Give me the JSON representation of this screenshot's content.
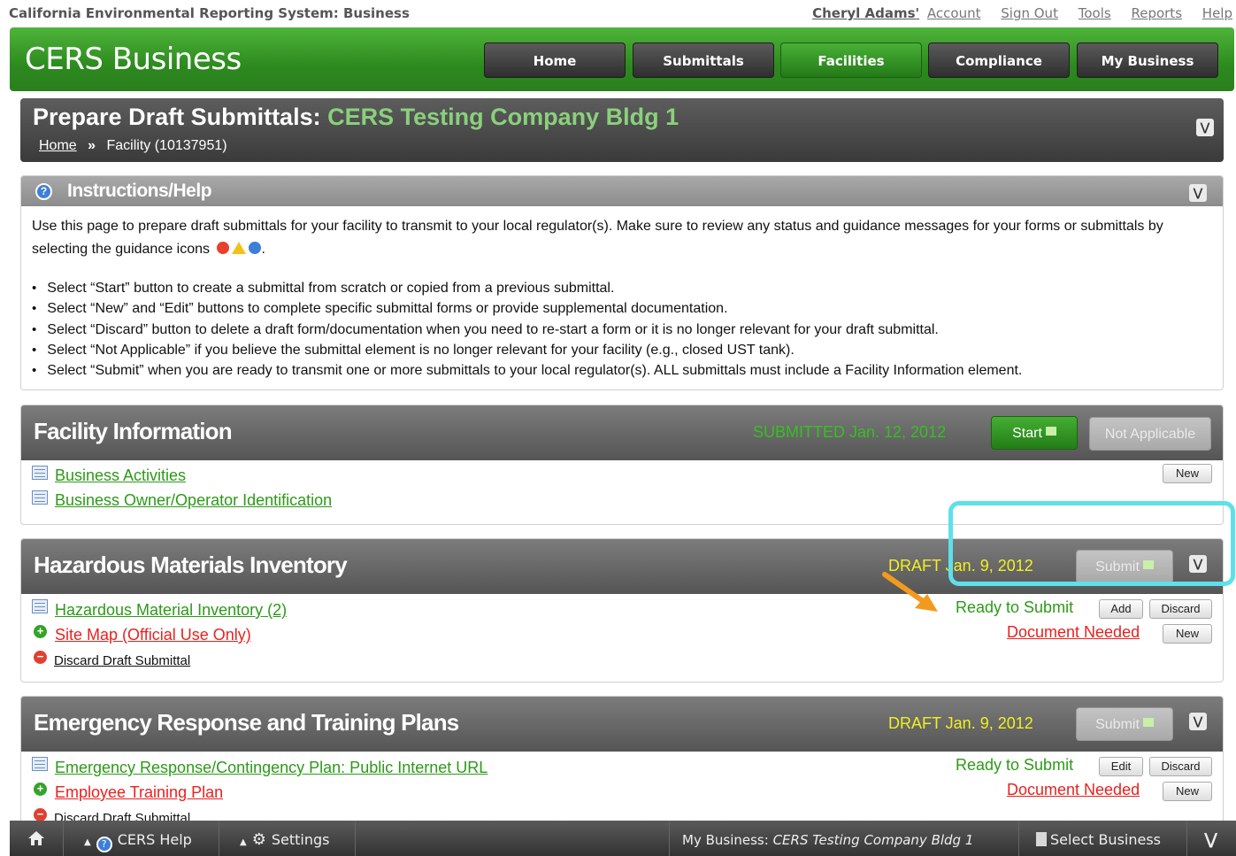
{
  "system_title": "California Environmental Reporting System: Business",
  "top_links": {
    "account_name": "Cheryl Adams'",
    "account": "Account",
    "sign_out": "Sign Out",
    "tools": "Tools",
    "reports": "Reports",
    "help": "Help"
  },
  "brand": "CERS Business",
  "nav": [
    "Home",
    "Submittals",
    "Facilities",
    "Compliance",
    "My Business"
  ],
  "nav_active": "Facilities",
  "page": {
    "title_prefix": "Prepare Draft Submittals:",
    "facility_name": "CERS Testing Company Bldg 1",
    "breadcrumb_home": "Home",
    "breadcrumb_sep": "»",
    "breadcrumb_current": "Facility (10137951)"
  },
  "instructions": {
    "title": "Instructions/Help",
    "intro_1": "Use this page to prepare draft submittals for your facility to transmit to your local regulator(s). Make sure to review any status and guidance messages for your forms or submittals by selecting the guidance icons",
    "intro_end": ".",
    "bullets": [
      "Select “Start” button to create a submittal from scratch or copied from a previous submittal.",
      "Select “New” and “Edit” buttons to complete specific submittal forms or provide supplemental documentation.",
      "Select “Discard” button to delete a draft form/documentation when you need to re-start a form or it is no longer relevant for your draft submittal.",
      "Select “Not Applicable” if you believe the submittal element is no longer relevant for your facility (e.g., closed UST tank).",
      "Select “Submit” when you are ready to transmit one or more submittals to your local regulator(s). ALL submittals must include a Facility Information element."
    ]
  },
  "sections": {
    "facility": {
      "title": "Facility Information",
      "status": "SUBMITTED Jan. 12, 2012",
      "start": "Start",
      "not_applicable": "Not Applicable",
      "items": [
        "Business Activities",
        "Business Owner/Operator Identification"
      ],
      "new": "New"
    },
    "hmi": {
      "title": "Hazardous Materials Inventory",
      "status": "DRAFT Jan. 9, 2012",
      "submit": "Submit",
      "item1": "Hazardous Material Inventory (2)",
      "item1_status": "Ready to Submit",
      "add": "Add",
      "discard": "Discard",
      "item2": "Site Map (Official Use Only)",
      "item2_status": "Document Needed",
      "new": "New",
      "discard_draft": "Discard Draft Submittal"
    },
    "ertp": {
      "title": "Emergency Response and Training Plans",
      "status": "DRAFT Jan. 9, 2012",
      "submit": "Submit",
      "item1": "Emergency Response/Contingency Plan: Public Internet URL",
      "item1_status": "Ready to Submit",
      "edit": "Edit",
      "discard": "Discard",
      "item2": "Employee Training Plan",
      "item2_status": "Document Needed",
      "new": "New",
      "discard_draft": "Discard Draft Submittal"
    }
  },
  "bottom_bar": {
    "help": "CERS Help",
    "settings": "Settings",
    "my_business_label": "My Business:",
    "my_business_name": "CERS Testing Company Bldg 1",
    "select_business": "Select Business"
  },
  "colors": {
    "brand_green": "#2d8a1f",
    "link_green": "#2c9a18",
    "alert_red": "#e8211f",
    "status_yellow": "#f0f020",
    "callout_cyan": "#5ee0ea",
    "arrow_orange": "#f39a1e"
  }
}
